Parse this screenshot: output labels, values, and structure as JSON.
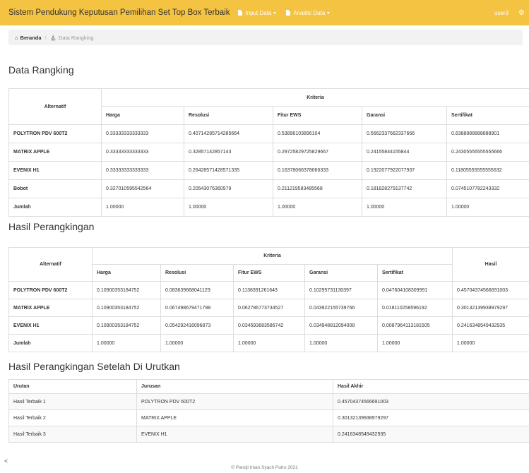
{
  "navbar": {
    "brand": "Sistem Pendukung Keputusan Pemilihan Set Top Box Terbaik",
    "menu": [
      {
        "label": "Input Data"
      },
      {
        "label": "Analitic Data"
      }
    ],
    "user": "user3",
    "settings_icon": "gear-icon",
    "menu_icon": "document-icon",
    "colors": {
      "navbar": "#f5c342",
      "text_on_nav": "#ffffff"
    }
  },
  "breadcrumb": {
    "home_icon": "home-icon",
    "home": "Beranda",
    "separator": "/",
    "current_icon": "bank-icon",
    "current": "Data Rangking"
  },
  "section1": {
    "title": "Data Rangking",
    "header_alt": "Alternatif",
    "header_kriteria": "Kriteria",
    "columns": [
      "Harga",
      "Resolusi",
      "Fitur EWS",
      "Garansi",
      "Sertifikat"
    ],
    "rows": [
      {
        "label": "POLYTRON PDV 600T2",
        "values": [
          "0.33333333333333",
          "0.40714285714285664",
          "0.53896103896104",
          "0.5662337662337666",
          "0.6388888888888901"
        ]
      },
      {
        "label": "MATRIX APPLE",
        "values": [
          "0.33333333333333",
          "0.32857142857143",
          "0.29725829725829667",
          "0.24155844155844",
          "0.24305555555555666"
        ]
      },
      {
        "label": "EVENIX H1",
        "values": [
          "0.33333333333333",
          "0.26428571428571335",
          "0.16378066378066333",
          "0.1922077922077937",
          "0.11805555555555632"
        ]
      },
      {
        "label": "Bobot",
        "values": [
          "0.327010595542564",
          "0.20543076360979",
          "0.211219583485568",
          "0.181828279137742",
          "0.0745107782243332"
        ]
      },
      {
        "label": "Jumlah",
        "values": [
          "1.00000",
          "1.00000",
          "1.00000",
          "1.00000",
          "1.00000"
        ]
      }
    ]
  },
  "section2": {
    "title": "Hasil Perangkingan",
    "header_alt": "Alternatif",
    "header_kriteria": "Kriteria",
    "header_hasil": "Hasil",
    "columns": [
      "Harga",
      "Resolusi",
      "Fitur EWS",
      "Garansi",
      "Sertifikat"
    ],
    "rows": [
      {
        "label": "POLYTRON PDV 600T2",
        "values": [
          "0.10900353184752",
          "0.083639668041129",
          "0.1138391261643",
          "0.10295731130397",
          "0.047604108309991",
          "0.45704374566691003"
        ]
      },
      {
        "label": "MATRIX APPLE",
        "values": [
          "0.10900353184752",
          "0.067498679471788",
          "0.062786773734527",
          "0.043922155739766",
          "0.018110258596192",
          "0.30132139938979297"
        ]
      },
      {
        "label": "EVENIX H1",
        "values": [
          "0.10900353184752",
          "0.054292416096873",
          "0.034593683586742",
          "0.034948812094008",
          "0.0087964113181505",
          "0.2416348549432935"
        ]
      },
      {
        "label": "Jumlah",
        "values": [
          "1.00000",
          "1.00000",
          "1.00000",
          "1.00000",
          "1.00000",
          "1.00000"
        ]
      }
    ]
  },
  "section3": {
    "title": "Hasil Perangkingan Setelah Di Urutkan",
    "columns": [
      "Urutan",
      "Jurusan",
      "Hasil Akhir"
    ],
    "rows": [
      [
        "Hasil Terbaik 1",
        "POLYTRON PDV 600T2",
        "0.45704374566691003"
      ],
      [
        "Hasil Terbaik 2",
        "MATRIX APPLE",
        "0.30132139938979297"
      ],
      [
        "Hasil Terbaik 3",
        "EVENIX H1",
        "0.2416348549432935"
      ]
    ]
  },
  "scroll_marker": "<",
  "footer": "© Pandji Iman Syach Putro 2021"
}
